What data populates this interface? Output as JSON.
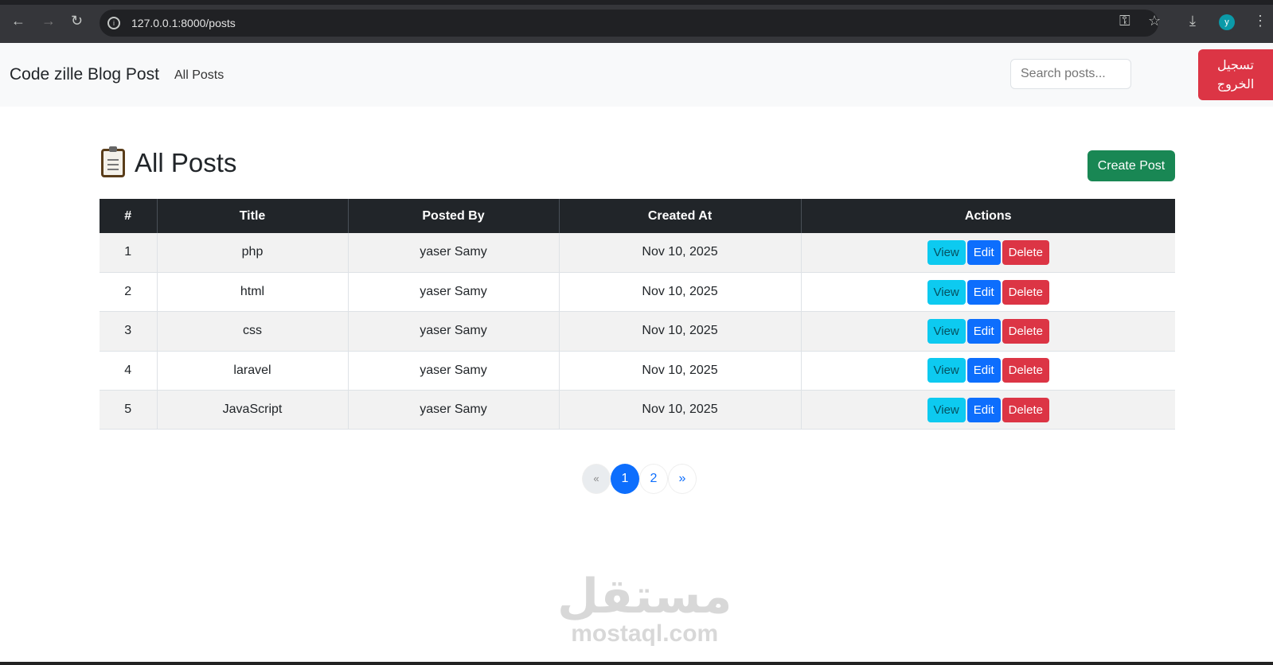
{
  "browser": {
    "url": "127.0.0.1:8000/posts",
    "profile_initial": "y"
  },
  "navbar": {
    "brand": "Code zille Blog Post",
    "link": "All Posts",
    "search_placeholder": "Search posts...",
    "logout": "تسجيل الخروج"
  },
  "page": {
    "title": "All Posts",
    "create_label": "Create Post"
  },
  "table": {
    "headers": [
      "#",
      "Title",
      "Posted By",
      "Created At",
      "Actions"
    ],
    "rows": [
      {
        "id": "1",
        "title": "php",
        "by": "yaser Samy",
        "date": "Nov 10, 2025"
      },
      {
        "id": "2",
        "title": "html",
        "by": "yaser Samy",
        "date": "Nov 10, 2025"
      },
      {
        "id": "3",
        "title": "css",
        "by": "yaser Samy",
        "date": "Nov 10, 2025"
      },
      {
        "id": "4",
        "title": "laravel",
        "by": "yaser Samy",
        "date": "Nov 10, 2025"
      },
      {
        "id": "5",
        "title": "JavaScript",
        "by": "yaser Samy",
        "date": "Nov 10, 2025"
      }
    ],
    "actions": {
      "view": "View",
      "edit": "Edit",
      "delete": "Delete"
    }
  },
  "pagination": {
    "prev": "«",
    "pages": [
      "1",
      "2"
    ],
    "next": "»",
    "current": "1"
  },
  "watermark": {
    "arabic": "مستقل",
    "latin": "mostaql.com"
  }
}
